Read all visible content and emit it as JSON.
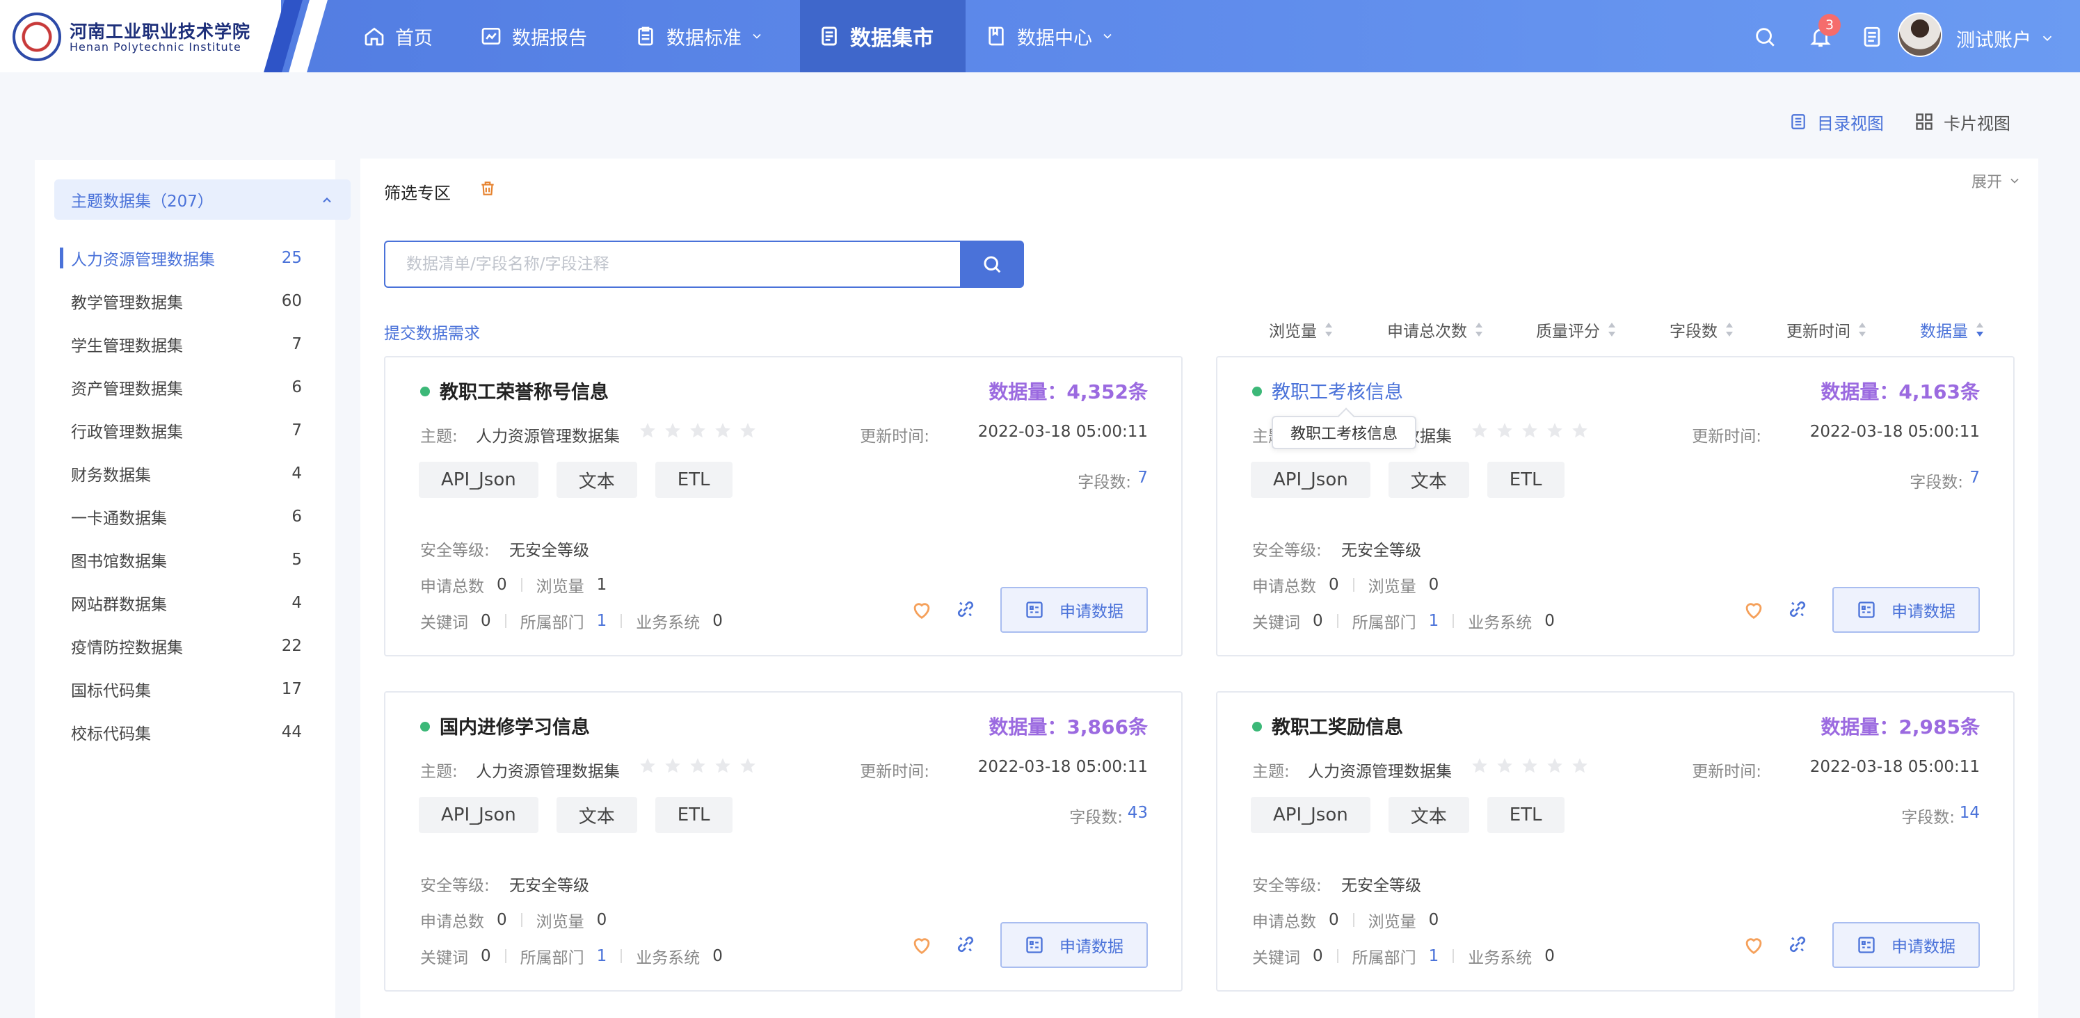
{
  "header": {
    "logo_cn": "河南工业职业技术学院",
    "logo_en": "Henan Polytechnic Institute",
    "nav": [
      {
        "label": "首页",
        "icon": "home-icon"
      },
      {
        "label": "数据报告",
        "icon": "report-icon"
      },
      {
        "label": "数据标准",
        "icon": "clipboard-icon",
        "dropdown": true
      },
      {
        "label": "数据集市",
        "icon": "document-icon",
        "active": true
      },
      {
        "label": "数据中心",
        "icon": "book-icon",
        "dropdown": true
      }
    ],
    "notification_count": "3",
    "account_name": "测试账户"
  },
  "view_switch": {
    "catalog_label": "目录视图",
    "card_label": "卡片视图"
  },
  "sidebar": {
    "head": "主题数据集（207）",
    "items": [
      {
        "name": "人力资源管理数据集",
        "count": "25",
        "active": true
      },
      {
        "name": "教学管理数据集",
        "count": "60"
      },
      {
        "name": "学生管理数据集",
        "count": "7"
      },
      {
        "name": "资产管理数据集",
        "count": "6"
      },
      {
        "name": "行政管理数据集",
        "count": "7"
      },
      {
        "name": "财务数据集",
        "count": "4"
      },
      {
        "name": "一卡通数据集",
        "count": "6"
      },
      {
        "name": "图书馆数据集",
        "count": "5"
      },
      {
        "name": "网站群数据集",
        "count": "4"
      },
      {
        "name": "疫情防控数据集",
        "count": "22"
      },
      {
        "name": "国标代码集",
        "count": "17"
      },
      {
        "name": "校标代码集",
        "count": "44"
      }
    ]
  },
  "filter": {
    "title": "筛选专区",
    "expand_label": "展开",
    "search_placeholder": "数据清单/字段名称/字段注释",
    "search_value": "",
    "submit_link": "提交数据需求",
    "sort": [
      {
        "label": "浏览量"
      },
      {
        "label": "申请总次数"
      },
      {
        "label": "质量评分"
      },
      {
        "label": "字段数"
      },
      {
        "label": "更新时间"
      },
      {
        "label": "数据量",
        "active": true
      }
    ]
  },
  "labels": {
    "topic": "主题:",
    "updated": "更新时间:",
    "fields": "字段数:",
    "security": "安全等级:",
    "apply_total": "申请总数",
    "views": "浏览量",
    "keywords": "关键词",
    "department": "所属部门",
    "business_system": "业务系统",
    "apply_button": "申请数据"
  },
  "cards": [
    {
      "title": "教职工荣誉称号信息",
      "volume": "数据量：4,352条",
      "topic": "人力资源管理数据集",
      "updated": "2022-03-18 05:00:11",
      "tags": [
        "API_Json",
        "文本",
        "ETL"
      ],
      "fields": "7",
      "security": "无安全等级",
      "apply_total": "0",
      "views": "1",
      "keywords": "0",
      "department": "1",
      "business_system": "0",
      "rating": 0
    },
    {
      "title": "教职工考核信息",
      "volume": "数据量：4,163条",
      "topic": "人力资源管理数据集",
      "updated": "2022-03-18 05:00:11",
      "tags": [
        "API_Json",
        "文本",
        "ETL"
      ],
      "fields": "7",
      "security": "无安全等级",
      "apply_total": "0",
      "views": "0",
      "keywords": "0",
      "department": "1",
      "business_system": "0",
      "rating": 0,
      "hovered": true
    },
    {
      "title": "国内进修学习信息",
      "volume": "数据量：3,866条",
      "topic": "人力资源管理数据集",
      "updated": "2022-03-18 05:00:11",
      "tags": [
        "API_Json",
        "文本",
        "ETL"
      ],
      "fields": "43",
      "security": "无安全等级",
      "apply_total": "0",
      "views": "0",
      "keywords": "0",
      "department": "1",
      "business_system": "0",
      "rating": 0
    },
    {
      "title": "教职工奖励信息",
      "volume": "数据量：2,985条",
      "topic": "人力资源管理数据集",
      "updated": "2022-03-18 05:00:11",
      "tags": [
        "API_Json",
        "文本",
        "ETL"
      ],
      "fields": "14",
      "security": "无安全等级",
      "apply_total": "0",
      "views": "0",
      "keywords": "0",
      "department": "1",
      "business_system": "0",
      "rating": 0
    }
  ],
  "tooltip": "教职工考核信息",
  "colors": {
    "primary": "#4a72d9",
    "volume": "#9b6ae0",
    "status_dot": "#3cb878",
    "badge": "#f56c6c",
    "favorite": "#f5a05a"
  }
}
